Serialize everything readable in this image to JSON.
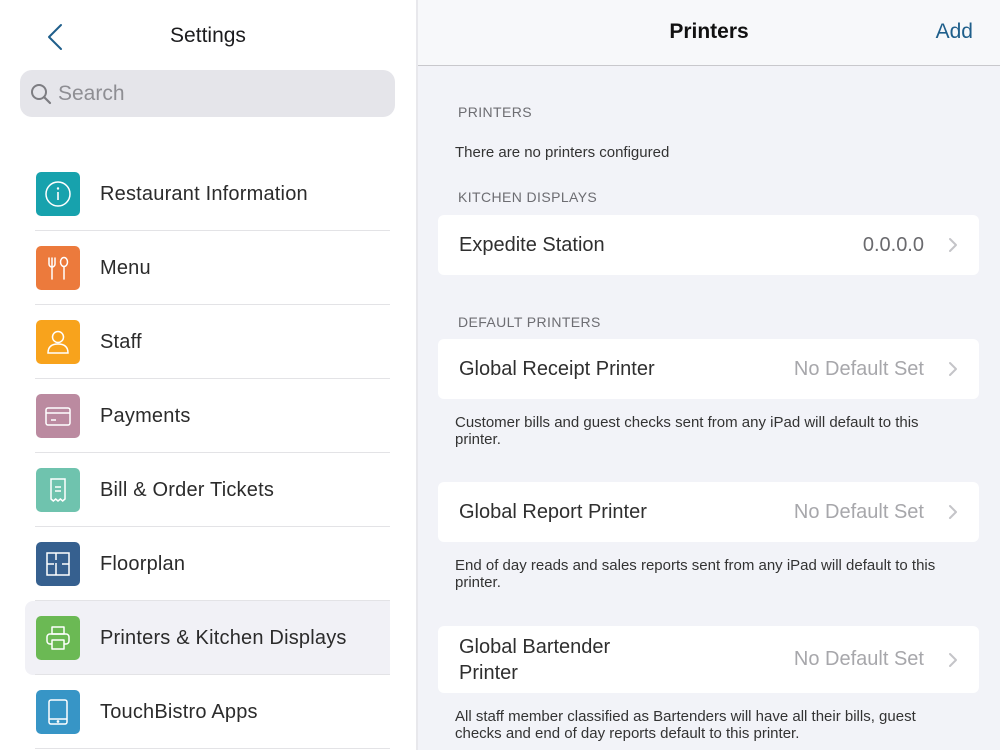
{
  "sidebar": {
    "title": "Settings",
    "back_icon": "chevron-left-icon",
    "search": {
      "placeholder": "Search",
      "value": ""
    },
    "items": [
      {
        "label": "Restaurant Information",
        "icon": "info-icon",
        "color": "#17a2ad",
        "active": false
      },
      {
        "label": "Menu",
        "icon": "fork-spoon-icon",
        "color": "#ec7a3c",
        "active": false
      },
      {
        "label": "Staff",
        "icon": "person-icon",
        "color": "#f8a31c",
        "active": false
      },
      {
        "label": "Payments",
        "icon": "credit-card-icon",
        "color": "#bb8aa0",
        "active": false
      },
      {
        "label": "Bill & Order Tickets",
        "icon": "receipt-icon",
        "color": "#6fc3ae",
        "active": false
      },
      {
        "label": "Floorplan",
        "icon": "floorplan-icon",
        "color": "#36608f",
        "active": false
      },
      {
        "label": "Printers & Kitchen Displays",
        "icon": "printer-icon",
        "color": "#6bb954",
        "active": true
      },
      {
        "label": "TouchBistro Apps",
        "icon": "tablet-icon",
        "color": "#3795c6",
        "active": false
      }
    ]
  },
  "detail": {
    "title": "Printers",
    "add_label": "Add",
    "accent": "#1f5f8b",
    "sections": {
      "printers": {
        "header": "PRINTERS",
        "empty_text": "There are no printers configured"
      },
      "kitchen_displays": {
        "header": "KITCHEN DISPLAYS",
        "rows": [
          {
            "label": "Expedite Station",
            "value": "0.0.0.0"
          }
        ]
      },
      "default_printers": {
        "header": "DEFAULT PRINTERS",
        "rows": [
          {
            "label": "Global Receipt Printer",
            "value": "No Default Set",
            "note": "Customer bills and guest checks sent from any iPad will default to this printer."
          },
          {
            "label": "Global Report Printer",
            "value": "No Default Set",
            "note": "End of day reads and sales reports sent from any iPad will default to this printer."
          },
          {
            "label": "Global Bartender Printer",
            "value": "No Default Set",
            "note": "All staff member classified as Bartenders will have all their bills, guest checks and end of day reports default to this printer."
          }
        ]
      }
    }
  }
}
